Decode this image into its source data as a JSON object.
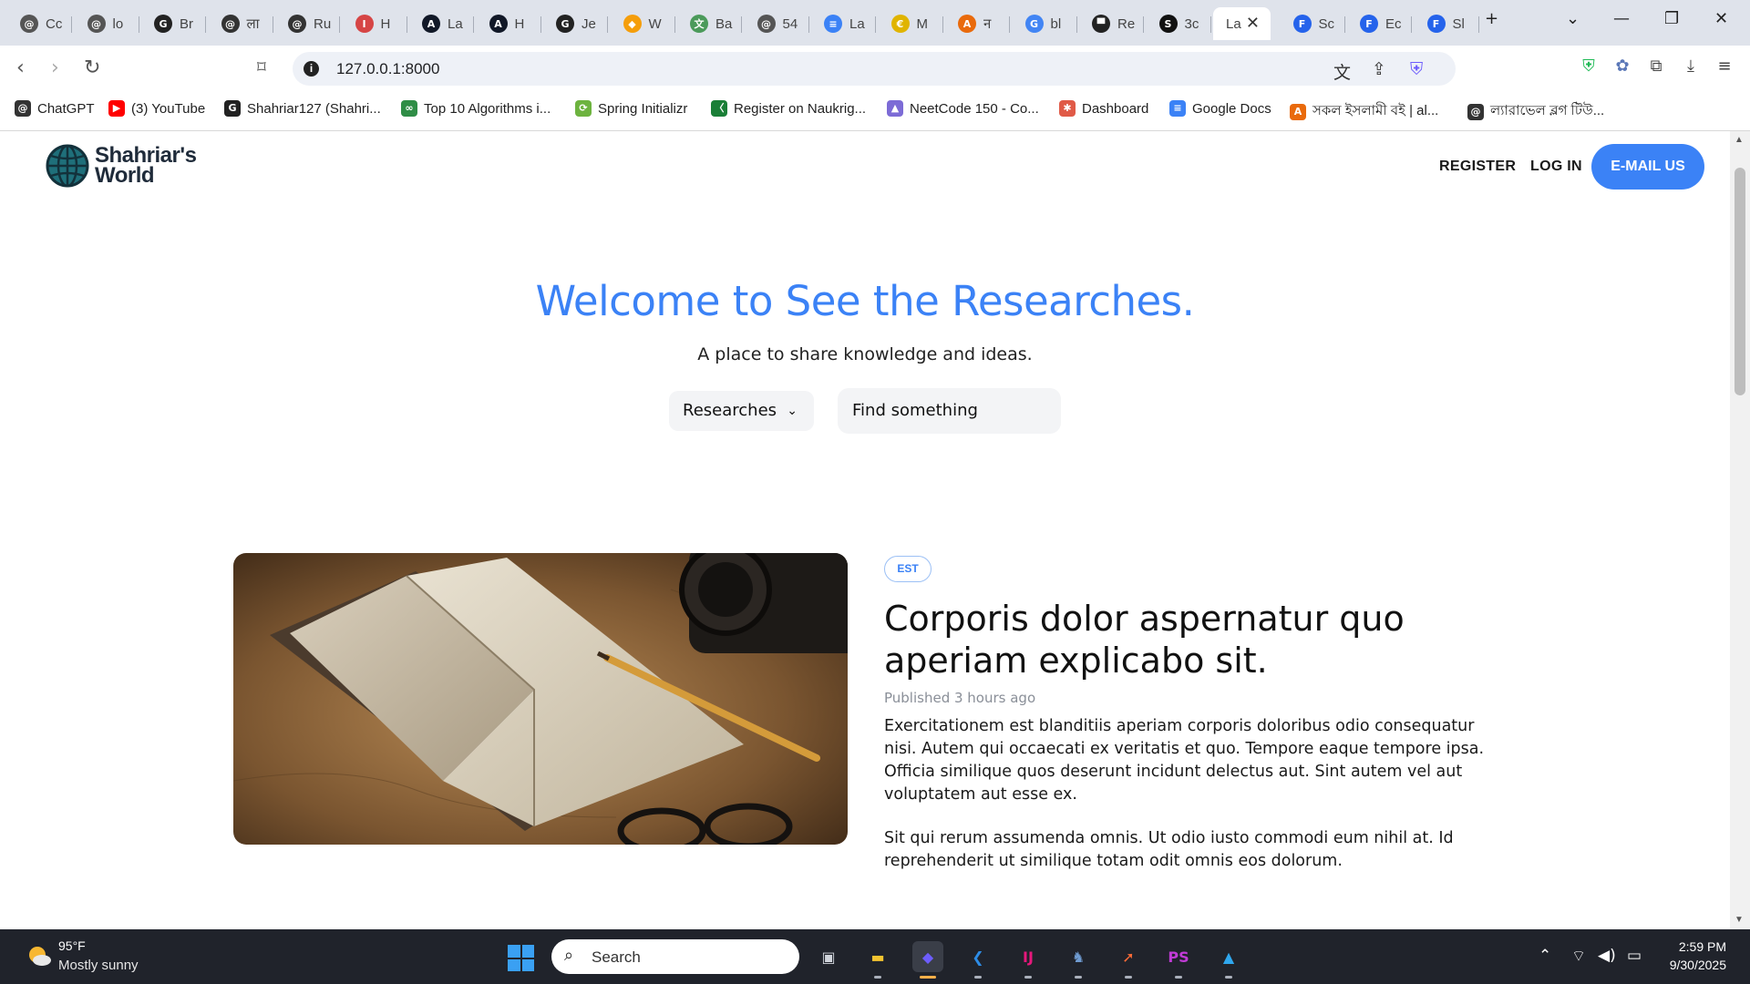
{
  "browser": {
    "tabs": [
      {
        "label": "Cc",
        "favicon": "openai-icon",
        "color": "#555555",
        "glyph": "@"
      },
      {
        "label": "lo",
        "favicon": "openai-icon",
        "color": "#555555",
        "glyph": "@"
      },
      {
        "label": "Br",
        "favicon": "github-icon",
        "color": "#222222",
        "glyph": "G"
      },
      {
        "label": "ला",
        "favicon": "openai-icon",
        "color": "#333333",
        "glyph": "@"
      },
      {
        "label": "Ru",
        "favicon": "openai-icon",
        "color": "#333333",
        "glyph": "@"
      },
      {
        "label": "H",
        "favicon": "iiuc-icon",
        "color": "#d64545",
        "glyph": "I"
      },
      {
        "label": "La",
        "favicon": "atcoder-icon",
        "color": "#111827",
        "glyph": "A"
      },
      {
        "label": "H",
        "favicon": "atcoder-icon",
        "color": "#111827",
        "glyph": "A"
      },
      {
        "label": "Je",
        "favicon": "github-icon",
        "color": "#222222",
        "glyph": "G"
      },
      {
        "label": "W",
        "favicon": "diamond-icon",
        "color": "#f59e0b",
        "glyph": "◆"
      },
      {
        "label": "Ba",
        "favicon": "translate-icon",
        "color": "#4b9a5a",
        "glyph": "文"
      },
      {
        "label": "54",
        "favicon": "world-icon",
        "color": "#555555",
        "glyph": "@"
      },
      {
        "label": "La",
        "favicon": "docs-icon",
        "color": "#3b82f6",
        "glyph": "≡"
      },
      {
        "label": "M",
        "favicon": "coin-icon",
        "color": "#e0b400",
        "glyph": "€"
      },
      {
        "label": "न",
        "favicon": "a-icon",
        "color": "#e96a0c",
        "glyph": "A"
      },
      {
        "label": "bl",
        "favicon": "google-icon",
        "color": "#4285f4",
        "glyph": "G"
      },
      {
        "label": "Re",
        "favicon": "printer-icon",
        "color": "#222222",
        "glyph": "▀"
      },
      {
        "label": "3c",
        "favicon": "s-icon",
        "color": "#111111",
        "glyph": "S"
      },
      {
        "label": "La",
        "favicon": "",
        "color": "#ffffff",
        "glyph": "",
        "active": true
      },
      {
        "label": "Sc",
        "favicon": "forms-icon",
        "color": "#2563eb",
        "glyph": "F"
      },
      {
        "label": "Ec",
        "favicon": "forms-icon",
        "color": "#2563eb",
        "glyph": "F"
      },
      {
        "label": "Sl",
        "favicon": "forms-icon",
        "color": "#2563eb",
        "glyph": "F"
      }
    ],
    "url": "127.0.0.1:8000",
    "bookmarks": [
      {
        "label": "ChatGPT",
        "icon": "openai-icon",
        "color": "#333333",
        "glyph": "@"
      },
      {
        "label": "(3) YouTube",
        "icon": "youtube-icon",
        "color": "#ff0000",
        "glyph": "▶"
      },
      {
        "label": "Shahriar127 (Shahri...",
        "icon": "github-icon",
        "color": "#222222",
        "glyph": "G"
      },
      {
        "label": "Top 10 Algorithms i...",
        "icon": "gfg-icon",
        "color": "#2f8d46",
        "glyph": "∞"
      },
      {
        "label": "Spring Initializr",
        "icon": "spring-icon",
        "color": "#6db33f",
        "glyph": "⟳"
      },
      {
        "label": "Register on Naukrig...",
        "icon": "naukri-icon",
        "color": "#1a7f37",
        "glyph": "〈"
      },
      {
        "label": "NeetCode 150 - Co...",
        "icon": "rocket-icon",
        "color": "#7c6bd6",
        "glyph": "▲"
      },
      {
        "label": "Dashboard",
        "icon": "dashboard-icon",
        "color": "#e05a47",
        "glyph": "✱"
      },
      {
        "label": "Google Docs",
        "icon": "docs-icon",
        "color": "#3b82f6",
        "glyph": "≡"
      },
      {
        "label": "সকল ইসলামী বই | al...",
        "icon": "a-icon",
        "color": "#e96a0c",
        "glyph": "A"
      },
      {
        "label": "ল্যারাভেল ব্লগ টিউ...",
        "icon": "openai-icon",
        "color": "#333333",
        "glyph": "@"
      }
    ]
  },
  "site": {
    "logo_line1": "Shahriar's",
    "logo_line2": "World",
    "nav": {
      "register": "REGISTER",
      "login": "LOG IN",
      "email": "E-MAIL US"
    },
    "hero": {
      "title": "Welcome to See the Researches.",
      "subtitle": "A place to share knowledge and ideas.",
      "category": "Researches",
      "search_placeholder": "Find something"
    },
    "post": {
      "badge": "EST",
      "title": "Corporis dolor aspernatur quo aperiam explicabo sit.",
      "meta": "Published 3 hours ago",
      "paragraph1": "Exercitationem est blanditiis aperiam corporis doloribus odio consequatur nisi. Autem qui occaecati ex veritatis et quo. Tempore eaque tempore ipsa. Officia similique quos deserunt incidunt delectus aut. Sint autem vel aut voluptatem aut esse ex.",
      "paragraph2": "Sit qui rerum assumenda omnis. Ut odio iusto commodi eum nihil at. Id reprehenderit ut similique totam odit omnis eos dolorum."
    }
  },
  "taskbar": {
    "temp": "95°F",
    "weather": "Mostly sunny",
    "search_placeholder": "Search",
    "time": "2:59 PM",
    "date": "9/30/2025",
    "apps": [
      {
        "name": "task-view-icon",
        "color": "#cfd3da",
        "glyph": "▣"
      },
      {
        "name": "file-explorer-icon",
        "color": "#f4c430",
        "glyph": "▬"
      },
      {
        "name": "shield-browser-icon",
        "color": "#6d5dfc",
        "glyph": "◆",
        "active": true
      },
      {
        "name": "vscode-icon",
        "color": "#2d8ce6",
        "glyph": "❮"
      },
      {
        "name": "intellij-icon",
        "color": "#e6187c",
        "glyph": "IJ"
      },
      {
        "name": "postgres-icon",
        "color": "#6f9bd1",
        "glyph": "♞"
      },
      {
        "name": "postman-icon",
        "color": "#ff6c37",
        "glyph": "➚"
      },
      {
        "name": "phpstorm-icon",
        "color": "#c13bd6",
        "glyph": "PS"
      },
      {
        "name": "photos-icon",
        "color": "#2fa7ee",
        "glyph": "▲"
      }
    ]
  }
}
